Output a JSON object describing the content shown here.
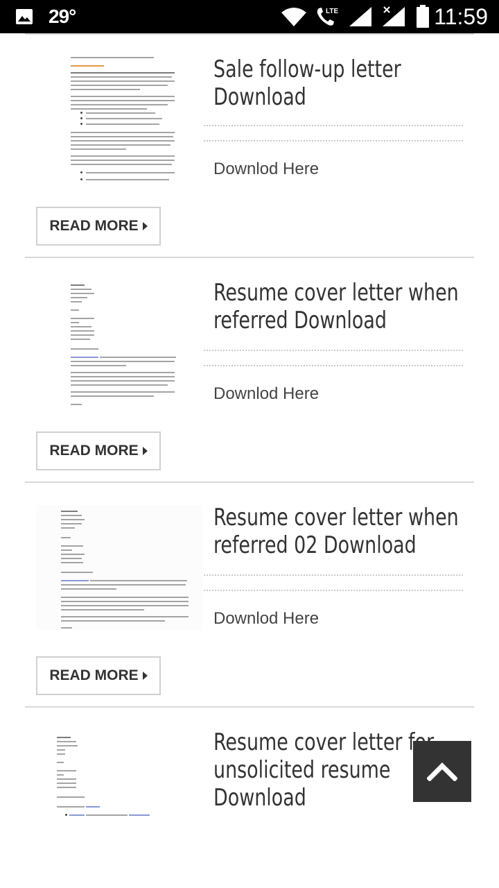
{
  "status_bar": {
    "temperature": "29°",
    "lte_label": "LTE",
    "time": "11:59",
    "icons": [
      "gallery-icon",
      "wifi-icon",
      "phone-lte-icon",
      "signal-icon",
      "signal-x-icon",
      "battery-icon"
    ]
  },
  "posts": [
    {
      "title": "Sale follow-up letter Download",
      "download_label": "Downlod Here",
      "read_more_label": "READ MORE"
    },
    {
      "title": "Resume cover letter when referred Download",
      "download_label": "Downlod Here",
      "read_more_label": "READ MORE"
    },
    {
      "title": "Resume cover letter when referred 02 Download",
      "download_label": "Downlod Here",
      "read_more_label": "READ MORE"
    },
    {
      "title": "Resume cover letter for unsolicited resume Download"
    }
  ],
  "back_to_top": {
    "icon": "chevron-up-icon"
  }
}
